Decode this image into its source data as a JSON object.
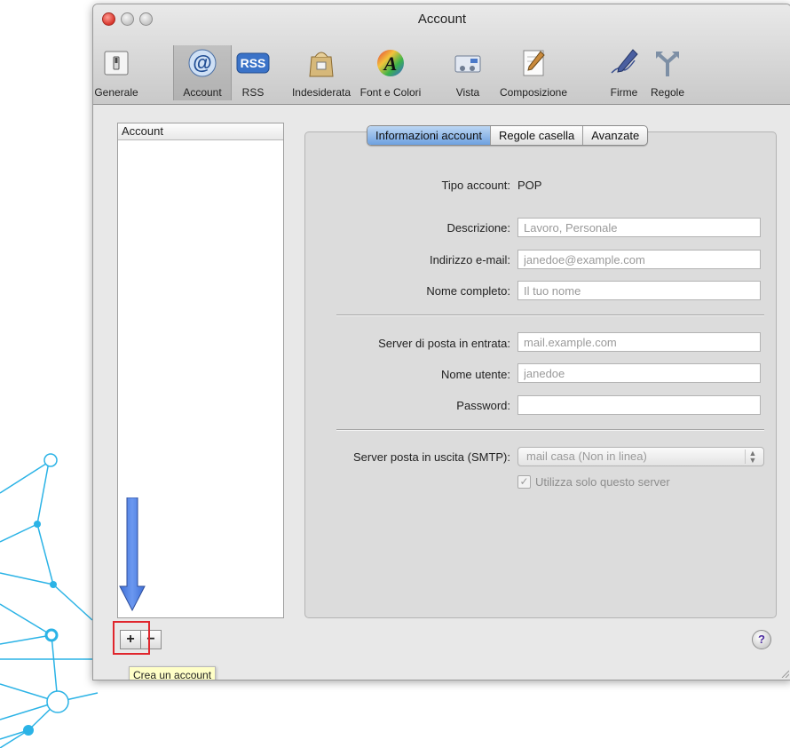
{
  "window": {
    "title": "Account"
  },
  "toolbar": {
    "items": [
      {
        "label": "Generale",
        "icon": "light-switch-icon"
      },
      {
        "label": "Account",
        "icon": "at-sign-icon"
      },
      {
        "label": "RSS",
        "icon": "rss-icon"
      },
      {
        "label": "Indesiderata",
        "icon": "junk-bag-icon"
      },
      {
        "label": "Font e Colori",
        "icon": "font-colors-icon"
      },
      {
        "label": "Vista",
        "icon": "view-icon"
      },
      {
        "label": "Composizione",
        "icon": "compose-pencil-icon"
      },
      {
        "label": "Firme",
        "icon": "signature-pen-icon"
      },
      {
        "label": "Regole",
        "icon": "rules-arrows-icon"
      }
    ],
    "selected": "Account"
  },
  "sidebar": {
    "header": "Account",
    "add_label": "+",
    "remove_label": "−",
    "tooltip": "Crea un account"
  },
  "tabs": [
    "Informazioni account",
    "Regole casella",
    "Avanzate"
  ],
  "active_tab": "Informazioni account",
  "form": {
    "account_type_label": "Tipo account:",
    "account_type_value": "POP",
    "description_label": "Descrizione:",
    "description_placeholder": "Lavoro, Personale",
    "email_label": "Indirizzo e-mail:",
    "email_placeholder": "janedoe@example.com",
    "fullname_label": "Nome completo:",
    "fullname_placeholder": "Il tuo nome",
    "incoming_label": "Server di posta in entrata:",
    "incoming_placeholder": "mail.example.com",
    "username_label": "Nome utente:",
    "username_placeholder": "janedoe",
    "password_label": "Password:",
    "password_value": "",
    "smtp_label": "Server posta in uscita (SMTP):",
    "smtp_value": "mail casa (Non in linea)",
    "only_server_label": "Utilizza solo questo server",
    "only_server_checked": true
  },
  "help": {
    "label": "?"
  },
  "colors": {
    "highlight_box": "#e0262d",
    "arrow": "#4a7de0",
    "active_tab": "#6ea1e0",
    "decoration": "#2bb3e6"
  }
}
